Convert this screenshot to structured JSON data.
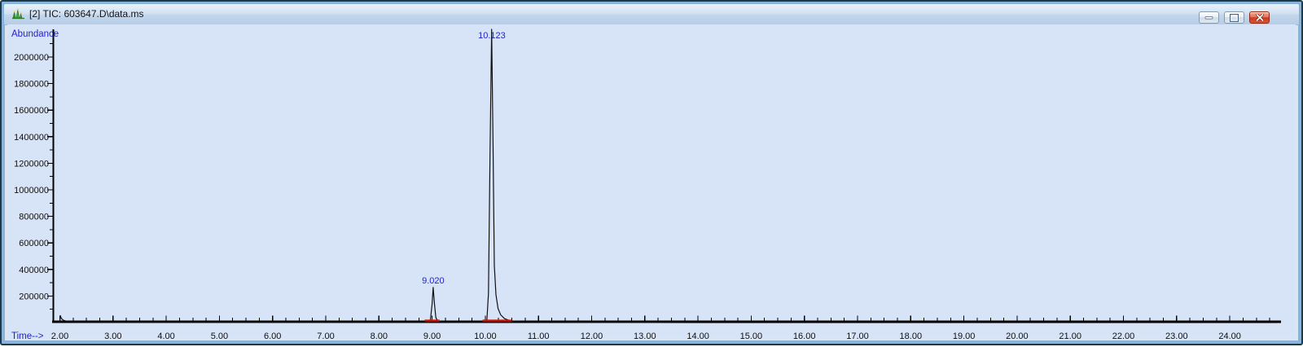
{
  "window": {
    "title": "[2] TIC: 603647.D\\data.ms",
    "controls": {
      "minimize": "Minimize",
      "maximize": "Maximize",
      "close": "Close"
    }
  },
  "colors": {
    "plot_background": "#d7e4f7",
    "axis": "#000000",
    "trace": "#111111",
    "integration_baseline": "#cc1100",
    "annotation_blue": "#2121cc",
    "tick_text": "#101010",
    "close_button_red": "#cc3a20"
  },
  "chart_data": {
    "type": "line",
    "title": "TIC: 603647.D\\data.ms",
    "xlabel": "Time-->",
    "ylabel": "Abundance",
    "xlim": [
      2.0,
      24.95
    ],
    "ylim": [
      0,
      2200000
    ],
    "grid": false,
    "legend": false,
    "x_major_ticks": [
      2,
      3,
      4,
      5,
      6,
      7,
      8,
      9,
      10,
      11,
      12,
      13,
      14,
      15,
      16,
      17,
      18,
      19,
      20,
      21,
      22,
      23,
      24
    ],
    "x_tick_labels": [
      "2.00",
      "3.00",
      "4.00",
      "5.00",
      "6.00",
      "7.00",
      "8.00",
      "9.00",
      "10.00",
      "11.00",
      "12.00",
      "13.00",
      "14.00",
      "15.00",
      "16.00",
      "17.00",
      "18.00",
      "19.00",
      "20.00",
      "21.00",
      "22.00",
      "23.00",
      "24.00"
    ],
    "x_minor_step": 0.25,
    "y_major_ticks": [
      200000,
      400000,
      600000,
      800000,
      1000000,
      1200000,
      1400000,
      1600000,
      1800000,
      2000000
    ],
    "y_tick_labels": [
      "200000",
      "400000",
      "600000",
      "800000",
      "1000000",
      "1200000",
      "1400000",
      "1600000",
      "1800000",
      "2000000"
    ],
    "y_minor_step": 100000,
    "series": [
      {
        "name": "TIC",
        "color": "#111111",
        "points": [
          [
            2.0,
            1500
          ],
          [
            2.01,
            52000
          ],
          [
            2.02,
            40000
          ],
          [
            2.04,
            26000
          ],
          [
            2.07,
            17000
          ],
          [
            2.11,
            12000
          ],
          [
            2.16,
            9500
          ],
          [
            2.22,
            8000
          ],
          [
            2.28,
            6500
          ],
          [
            2.36,
            7500
          ],
          [
            2.42,
            5000
          ],
          [
            2.5,
            6500
          ],
          [
            2.58,
            4200
          ],
          [
            2.66,
            5800
          ],
          [
            2.74,
            3800
          ],
          [
            2.84,
            5000
          ],
          [
            2.95,
            3200
          ],
          [
            3.08,
            4200
          ],
          [
            3.2,
            2600
          ],
          [
            3.34,
            3400
          ],
          [
            3.5,
            2000
          ],
          [
            3.66,
            2600
          ],
          [
            3.85,
            1200
          ],
          [
            4.1,
            700
          ],
          [
            4.5,
            450
          ],
          [
            5.2,
            350
          ],
          [
            6.0,
            350
          ],
          [
            7.0,
            350
          ],
          [
            7.8,
            450
          ],
          [
            8.02,
            2200
          ],
          [
            8.08,
            700
          ],
          [
            8.14,
            2500
          ],
          [
            8.2,
            900
          ],
          [
            8.27,
            2200
          ],
          [
            8.34,
            800
          ],
          [
            8.42,
            1800
          ],
          [
            8.52,
            600
          ],
          [
            8.7,
            450
          ],
          [
            8.88,
            700
          ],
          [
            8.94,
            2500
          ],
          [
            8.97,
            25000
          ],
          [
            9.0,
            140000
          ],
          [
            9.02,
            265000
          ],
          [
            9.045,
            140000
          ],
          [
            9.07,
            38000
          ],
          [
            9.1,
            14000
          ],
          [
            9.14,
            8000
          ],
          [
            9.2,
            4000
          ],
          [
            9.3,
            1800
          ],
          [
            9.45,
            900
          ],
          [
            9.65,
            600
          ],
          [
            9.85,
            800
          ],
          [
            9.98,
            1800
          ],
          [
            10.03,
            22000
          ],
          [
            10.06,
            220000
          ],
          [
            10.09,
            1300000
          ],
          [
            10.12,
            2400000
          ],
          [
            10.145,
            1350000
          ],
          [
            10.17,
            430000
          ],
          [
            10.2,
            210000
          ],
          [
            10.24,
            105000
          ],
          [
            10.29,
            58000
          ],
          [
            10.36,
            30000
          ],
          [
            10.45,
            16000
          ],
          [
            10.56,
            10000
          ],
          [
            10.68,
            7500
          ],
          [
            10.8,
            8500
          ],
          [
            10.9,
            5000
          ],
          [
            11.0,
            7500
          ],
          [
            11.1,
            4200
          ],
          [
            11.2,
            6500
          ],
          [
            11.32,
            3500
          ],
          [
            11.45,
            5000
          ],
          [
            11.6,
            2200
          ],
          [
            11.8,
            2800
          ],
          [
            12.0,
            1200
          ],
          [
            12.3,
            700
          ],
          [
            12.7,
            450
          ],
          [
            13.2,
            350
          ],
          [
            14.0,
            300
          ],
          [
            16.0,
            300
          ],
          [
            18.0,
            300
          ],
          [
            20.0,
            300
          ],
          [
            22.0,
            300
          ],
          [
            24.0,
            300
          ],
          [
            24.9,
            300
          ]
        ]
      }
    ],
    "integration_baselines": {
      "color": "#cc1100",
      "time_segments": [
        [
          8.86,
          9.14
        ],
        [
          9.95,
          10.5
        ]
      ]
    },
    "peak_labels": [
      {
        "label": "9.020",
        "time": 9.02,
        "abundance": 265000
      },
      {
        "label": "10.123",
        "time": 10.123,
        "abundance": 2400000
      }
    ]
  }
}
